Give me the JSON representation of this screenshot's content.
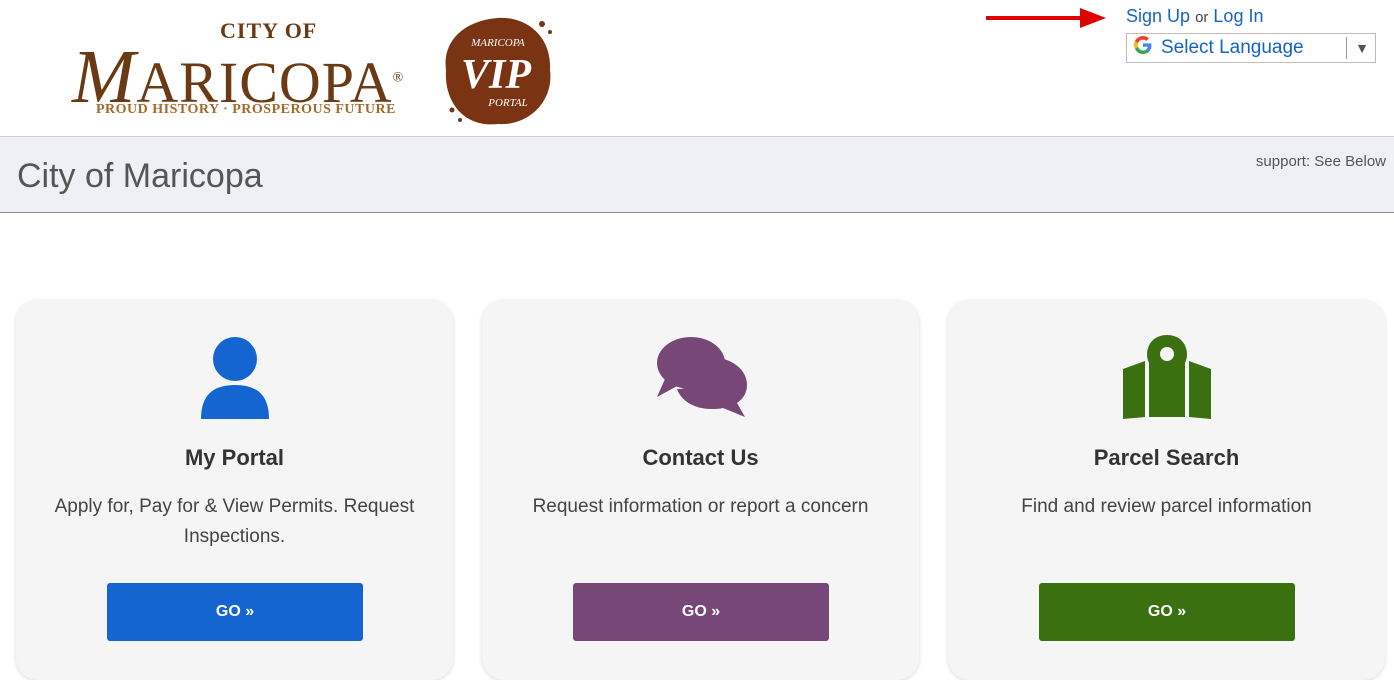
{
  "header": {
    "logo": {
      "city_of": "CITY OF",
      "maricopa_initial": "M",
      "maricopa_rest": "ARICOPA",
      "tagline": "PROUD HISTORY · PROSPEROUS FUTURE",
      "seal_top": "MARICOPA",
      "seal_main": "VIP",
      "seal_bottom": "PORTAL"
    },
    "auth": {
      "sign_up": "Sign Up",
      "or": "or",
      "log_in": "Log In"
    },
    "language": {
      "label": "Select Language",
      "icon": "google-g-icon"
    },
    "annotation_arrow_color": "#e00000"
  },
  "title_band": {
    "title": "City of Maricopa",
    "support": "support: See Below"
  },
  "cards": [
    {
      "icon": "user-icon",
      "title": "My Portal",
      "desc": "Apply for, Pay for & View Permits. Request Inspections.",
      "button": "GO »",
      "color": "#1565d0"
    },
    {
      "icon": "chat-bubbles-icon",
      "title": "Contact Us",
      "desc": "Request information or report a concern",
      "button": "GO »",
      "color": "#774877"
    },
    {
      "icon": "map-pin-icon",
      "title": "Parcel Search",
      "desc": "Find and review parcel information",
      "button": "GO »",
      "color": "#3a7010"
    }
  ]
}
